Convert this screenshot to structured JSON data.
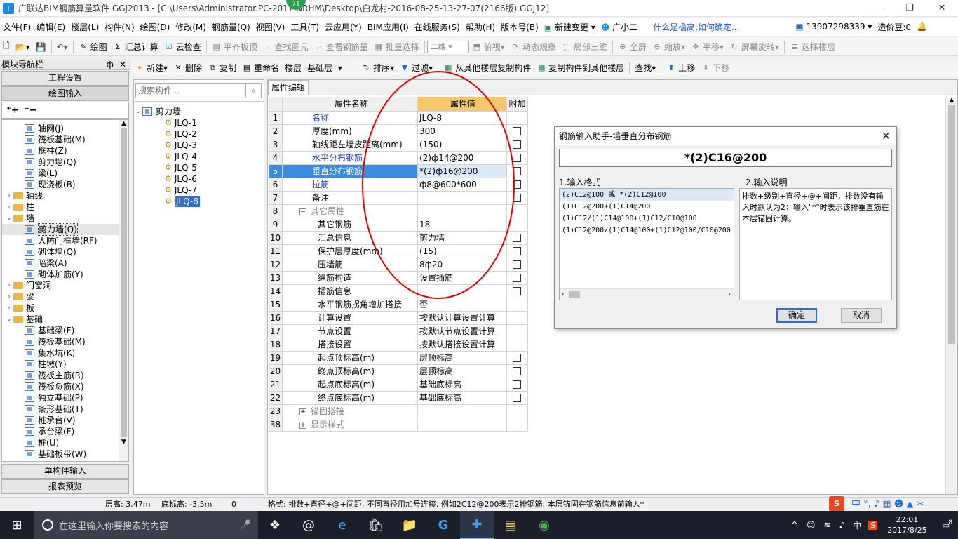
{
  "window": {
    "title": "广联达BIM钢筋算量软件 GGJ2013 - [C:\\Users\\Administrator.PC-2017           NRHM\\Desktop\\白龙村-2016-08-25-13-27-07(2166版).GGJ12]",
    "badge": "71",
    "min": "—",
    "restore": "❐",
    "close": "✕"
  },
  "menu": {
    "items": [
      "文件(F)",
      "编辑(E)",
      "楼层(L)",
      "构件(N)",
      "绘图(D)",
      "修改(M)",
      "钢筋量(Q)",
      "视图(V)",
      "工具(T)",
      "云应用(Y)",
      "BIM应用(I)",
      "在线服务(S)",
      "帮助(H)",
      "版本号(B)"
    ],
    "new_change": "新建变更",
    "assistant": "广小二",
    "hint": "什么是檐高,如何确定...",
    "phone": "13907298339",
    "cost_coin": "造价豆:0"
  },
  "toolbar1": {
    "draw": "绘图",
    "sum": "汇总计算",
    "cloud_check": "云检查",
    "flat_top": "平齐板顶",
    "find_elem": "查找图元",
    "view_rebar": "查看钢筋量",
    "batch_select": "批量选择",
    "view_mode": "二维",
    "overlook": "俯视",
    "dynamic": "动态观察",
    "local3d": "局部三维",
    "fullscreen": "全屏",
    "zoom": "缩放",
    "pan": "平移",
    "rotate": "屏幕旋转",
    "select_floor": "选择楼层"
  },
  "toolbar2": {
    "new": "新建",
    "delete": "删除",
    "copy": "复制",
    "rename": "重命名",
    "floor_label": "楼层",
    "floor_value": "基础层",
    "sort": "排序",
    "filter": "过滤",
    "copy_from": "从其他楼层复制构件",
    "copy_to": "复制构件到其他楼层",
    "find": "查找",
    "move_up": "上移",
    "move_down": "下移"
  },
  "nav": {
    "header": "模块导航栏",
    "pin": "ф",
    "close": "✕",
    "project_settings": "工程设置",
    "draw_input": "绘图输入",
    "single_input": "单构件输入",
    "report_preview": "报表预览",
    "tree": [
      {
        "level": 2,
        "icon": "grid-icon",
        "label": "轴网(J)"
      },
      {
        "level": 2,
        "icon": "raft-icon",
        "label": "筏板基础(M)"
      },
      {
        "level": 2,
        "icon": "frame-column-icon",
        "label": "框柱(Z)"
      },
      {
        "level": 2,
        "icon": "shear-wall-icon",
        "label": "剪力墙(Q)"
      },
      {
        "level": 2,
        "icon": "beam-icon",
        "label": "梁(L)"
      },
      {
        "level": 2,
        "icon": "slab-icon",
        "label": "现浇板(B)"
      },
      {
        "level": 1,
        "folder": true,
        "exp": "›",
        "label": "轴线"
      },
      {
        "level": 1,
        "folder": true,
        "exp": "›",
        "label": "柱"
      },
      {
        "level": 1,
        "folder": true,
        "exp": "⌄",
        "label": "墙"
      },
      {
        "level": 2,
        "icon": "shear-wall-icon",
        "label": "剪力墙(Q)",
        "selected": true
      },
      {
        "level": 2,
        "icon": "door-frame-icon",
        "label": "人防门框墙(RF)"
      },
      {
        "level": 2,
        "icon": "masonry-wall-icon",
        "label": "砌体墙(Q)"
      },
      {
        "level": 2,
        "icon": "hidden-beam-icon",
        "label": "暗梁(A)"
      },
      {
        "level": 2,
        "icon": "masonry-rebar-icon",
        "label": "砌体加筋(Y)"
      },
      {
        "level": 1,
        "folder": true,
        "exp": "›",
        "label": "门窗洞"
      },
      {
        "level": 1,
        "folder": true,
        "exp": "›",
        "label": "梁"
      },
      {
        "level": 1,
        "folder": true,
        "exp": "›",
        "label": "板"
      },
      {
        "level": 1,
        "folder": true,
        "exp": "⌄",
        "label": "基础"
      },
      {
        "level": 2,
        "icon": "foundation-beam-icon",
        "label": "基础梁(F)"
      },
      {
        "level": 2,
        "icon": "raft-icon",
        "label": "筏板基础(M)"
      },
      {
        "level": 2,
        "icon": "sump-icon",
        "label": "集水坑(K)"
      },
      {
        "level": 2,
        "icon": "pier-icon",
        "label": "柱墩(Y)"
      },
      {
        "level": 2,
        "icon": "raft-main-rebar-icon",
        "label": "筏板主筋(R)"
      },
      {
        "level": 2,
        "icon": "raft-neg-rebar-icon",
        "label": "筏板负筋(X)"
      },
      {
        "level": 2,
        "icon": "isolated-footing-icon",
        "label": "独立基础(P)"
      },
      {
        "level": 2,
        "icon": "strip-footing-icon",
        "label": "条形基础(T)"
      },
      {
        "level": 2,
        "icon": "pile-cap-icon",
        "label": "桩承台(V)"
      },
      {
        "level": 2,
        "icon": "cap-beam-icon",
        "label": "承台梁(F)"
      },
      {
        "level": 2,
        "icon": "pile-icon",
        "label": "桩(U)"
      },
      {
        "level": 2,
        "icon": "foundation-strip-icon",
        "label": "基础板带(W)"
      }
    ]
  },
  "components": {
    "search_placeholder": "搜索构件...",
    "root": "剪力墙",
    "items": [
      "JLQ-1",
      "JLQ-2",
      "JLQ-3",
      "JLQ-4",
      "JLQ-5",
      "JLQ-6",
      "JLQ-7",
      "JLQ-8"
    ],
    "selected": "JLQ-8"
  },
  "props": {
    "tab": "属性编辑",
    "col_name": "属性名称",
    "col_value": "属性值",
    "col_extra": "附加",
    "rows": [
      {
        "no": "1",
        "name": "名称",
        "value": "JLQ-8",
        "blue": true,
        "chk": false
      },
      {
        "no": "2",
        "name": "厚度(mm)",
        "value": "300",
        "chk": true
      },
      {
        "no": "3",
        "name": "轴线距左墙皮距离(mm)",
        "value": "(150)",
        "chk": true
      },
      {
        "no": "4",
        "name": "水平分布钢筋",
        "value": "(2)ф14@200",
        "blue": true,
        "chk": true
      },
      {
        "no": "5",
        "name": "垂直分布钢筋",
        "value": "*(2)ф16@200",
        "blue": true,
        "chk": true,
        "selected": true
      },
      {
        "no": "6",
        "name": "拉筋",
        "value": "ф8@600*600",
        "blue": true,
        "chk": true
      },
      {
        "no": "7",
        "name": "备注",
        "value": "",
        "chk": true
      },
      {
        "no": "8",
        "name": "其它属性",
        "value": "",
        "group": "−",
        "gray": true
      },
      {
        "no": "9",
        "name": "其它钢筋",
        "value": "18",
        "indent": true
      },
      {
        "no": "10",
        "name": "汇总信息",
        "value": "剪力墙",
        "indent": true,
        "chk": true
      },
      {
        "no": "11",
        "name": "保护层厚度(mm)",
        "value": "(15)",
        "indent": true,
        "chk": true
      },
      {
        "no": "12",
        "name": "压墙筋",
        "value": "8ф20",
        "indent": true,
        "chk": true
      },
      {
        "no": "13",
        "name": "纵筋构造",
        "value": "设置插筋",
        "indent": true,
        "chk": true
      },
      {
        "no": "14",
        "name": "插筋信息",
        "value": "",
        "indent": true,
        "chk": true
      },
      {
        "no": "15",
        "name": "水平钢筋拐角增加搭接",
        "value": "否",
        "indent": true
      },
      {
        "no": "16",
        "name": "计算设置",
        "value": "按默认计算设置计算",
        "indent": true
      },
      {
        "no": "17",
        "name": "节点设置",
        "value": "按默认节点设置计算",
        "indent": true
      },
      {
        "no": "18",
        "name": "搭接设置",
        "value": "按默认搭接设置计算",
        "indent": true
      },
      {
        "no": "19",
        "name": "起点顶标高(m)",
        "value": "层顶标高",
        "indent": true,
        "chk": true
      },
      {
        "no": "20",
        "name": "终点顶标高(m)",
        "value": "层顶标高",
        "indent": true,
        "chk": true
      },
      {
        "no": "21",
        "name": "起点底标高(m)",
        "value": "基础底标高",
        "indent": true,
        "chk": true
      },
      {
        "no": "22",
        "name": "终点底标高(m)",
        "value": "基础底标高",
        "indent": true,
        "chk": true
      },
      {
        "no": "23",
        "name": "锚固搭接",
        "value": "",
        "group": "+",
        "gray": true
      },
      {
        "no": "38",
        "name": "显示样式",
        "value": "",
        "group": "+",
        "gray": true
      }
    ]
  },
  "dialog": {
    "title": "钢筋输入助手-墙垂直分布钢筋",
    "close": "✕",
    "input": "*(2)C16@200",
    "format_label": "1.输入格式",
    "desc_label": "2.输入说明",
    "formats": [
      "(2)C12@100 或 *(2)C12@100",
      "(1)C12@200+(1)C14@200",
      "(1)C12/(1)C14@100+(1)C12/C10@100",
      "(1)C12@200/(1)C14@100+(1)C12@100/C10@200"
    ],
    "description": "排数+级别+直径+@+间距，排数没有输入时默认为2；输入\"*\"时表示该排垂直筋在本层锚固计算。",
    "ok": "确定",
    "cancel": "取消"
  },
  "status": {
    "floor_height": "层高: 3.47m",
    "bottom_elev": "底标高: -3.5m",
    "zero": "0",
    "message": "格式: 排数+直径+@+间距, 不同直径用加号连接, 例如2C12@200表示2排钢筋; 本层锚固在钢筋信息前输入*"
  },
  "taskbar": {
    "search_placeholder": "在这里输入你要搜索的内容",
    "time": "22:01",
    "date": "2017/8/25",
    "ime": "中",
    "notif": "8"
  }
}
